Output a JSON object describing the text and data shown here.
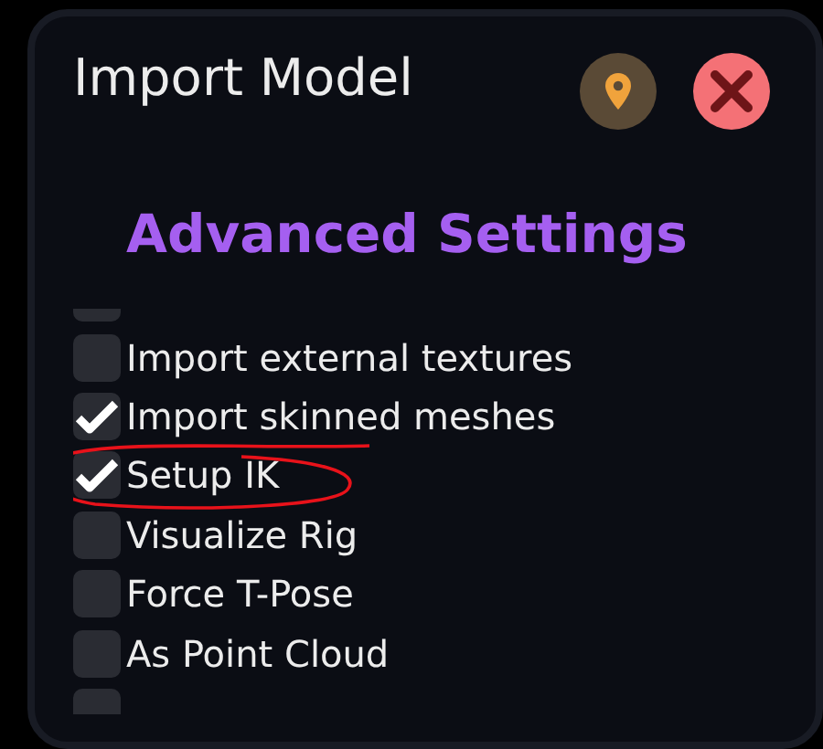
{
  "window": {
    "title": "Import Model"
  },
  "section": {
    "title": "Advanced Settings"
  },
  "options": [
    {
      "checked": false
    },
    {
      "label": "Import external textures",
      "checked": false
    },
    {
      "label": "Import skinned meshes",
      "checked": true
    },
    {
      "label": "Setup IK",
      "checked": true,
      "highlighted": true
    },
    {
      "label": "Visualize Rig",
      "checked": false
    },
    {
      "label": "Force T-Pose",
      "checked": false
    },
    {
      "label": "As Point Cloud",
      "checked": false
    },
    {
      "checked": false
    }
  ]
}
